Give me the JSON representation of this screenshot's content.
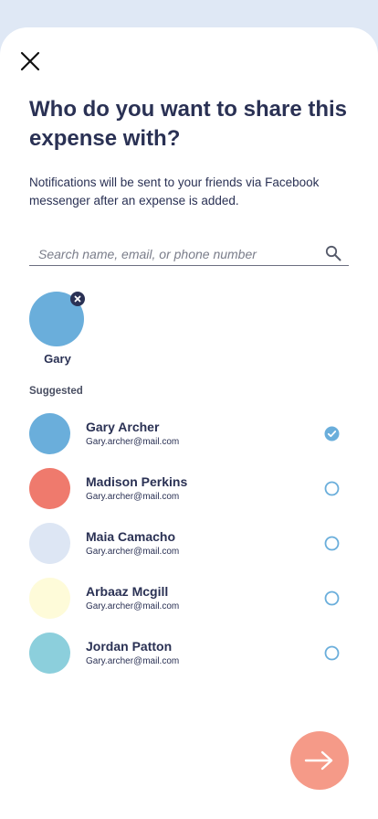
{
  "header": {
    "title": "Who do you want to share this expense with?",
    "subtitle": "Notifications will be sent to your friends via Facebook messenger after an expense is added."
  },
  "search": {
    "placeholder": "Search name, email, or phone number",
    "value": ""
  },
  "selected": [
    {
      "name": "Gary",
      "color": "#6aaedb"
    }
  ],
  "suggested": {
    "label": "Suggested",
    "contacts": [
      {
        "name": "Gary Archer",
        "email": "Gary.archer@mail.com",
        "color": "#6aaedb",
        "selected": true
      },
      {
        "name": "Madison Perkins",
        "email": "Gary.archer@mail.com",
        "color": "#ef7a6d",
        "selected": false
      },
      {
        "name": "Maia Camacho",
        "email": "Gary.archer@mail.com",
        "color": "#dde6f4",
        "selected": false
      },
      {
        "name": "Arbaaz Mcgill",
        "email": "Gary.archer@mail.com",
        "color": "#fefbd9",
        "selected": false
      },
      {
        "name": "Jordan Patton",
        "email": "Gary.archer@mail.com",
        "color": "#8ccfdc",
        "selected": false
      }
    ]
  },
  "icons": {
    "close": "close-icon",
    "search": "search-icon",
    "remove": "remove-icon",
    "check": "check-icon",
    "next": "arrow-right-icon"
  },
  "colors": {
    "accent": "#6aaedb",
    "text": "#2a3154",
    "next_button": "#f59a88",
    "background": "#dfe8f5"
  }
}
